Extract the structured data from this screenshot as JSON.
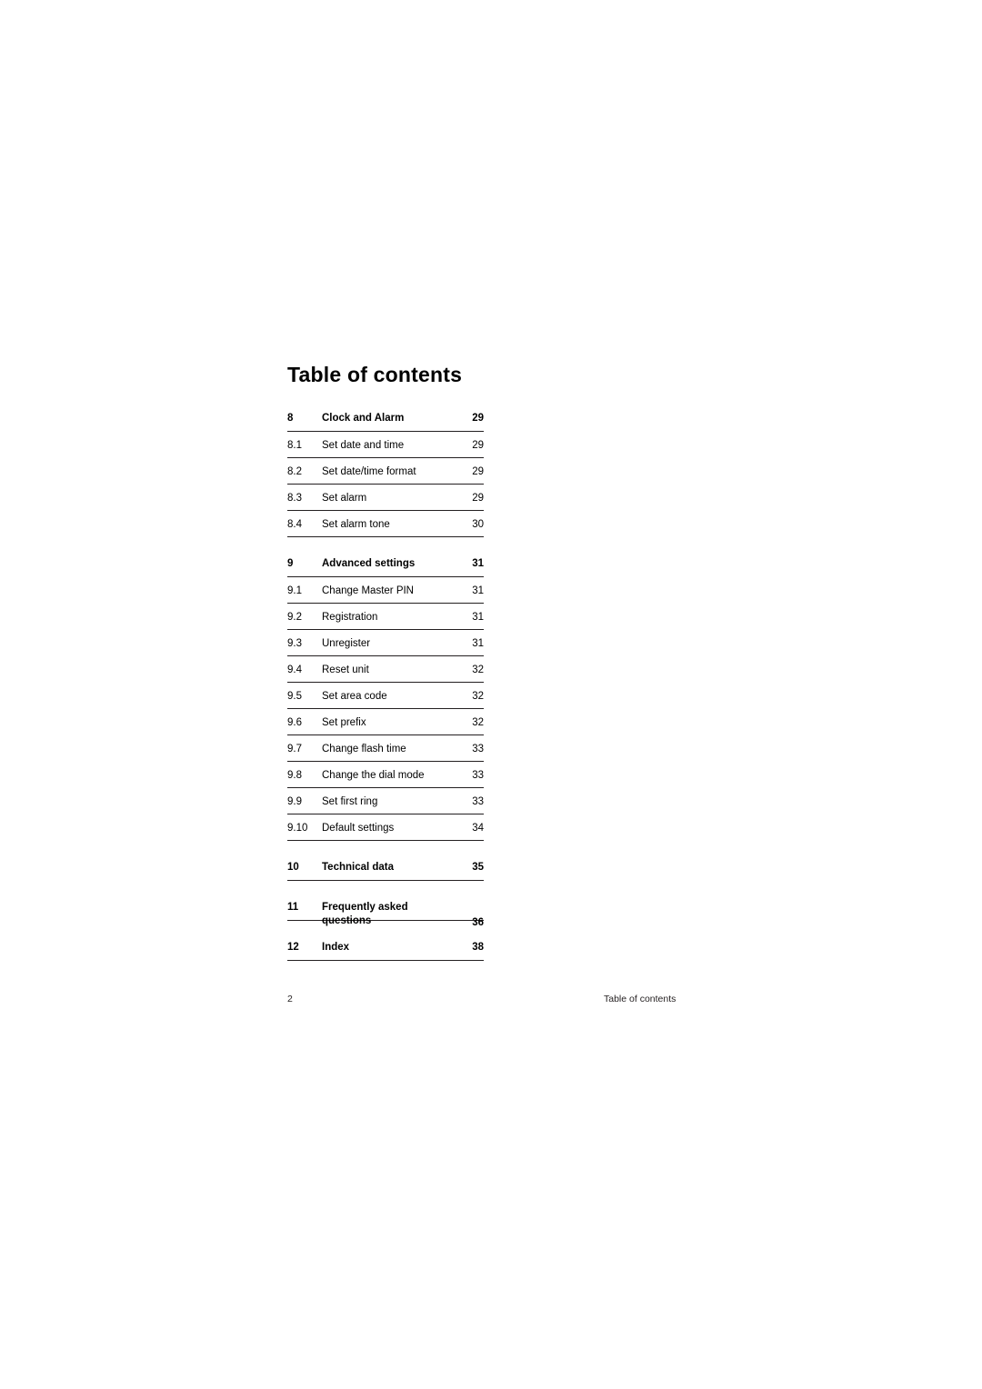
{
  "page": {
    "title": "Table of contents",
    "footer_folio": "2",
    "footer_label": "Table of contents"
  },
  "toc": {
    "groups": [
      {
        "entries": [
          {
            "num": "8",
            "label": "Clock and Alarm",
            "page": "29",
            "chapter": true
          },
          {
            "num": "8.1",
            "label": "Set date and time",
            "page": "29",
            "chapter": false
          },
          {
            "num": "8.2",
            "label": "Set date/time format",
            "page": "29",
            "chapter": false
          },
          {
            "num": "8.3",
            "label": "Set alarm",
            "page": "29",
            "chapter": false
          },
          {
            "num": "8.4",
            "label": "Set alarm tone",
            "page": "30",
            "chapter": false
          }
        ]
      },
      {
        "entries": [
          {
            "num": "9",
            "label": "Advanced settings",
            "page": "31",
            "chapter": true
          },
          {
            "num": "9.1",
            "label": "Change Master PIN",
            "page": "31",
            "chapter": false
          },
          {
            "num": "9.2",
            "label": "Registration",
            "page": "31",
            "chapter": false
          },
          {
            "num": "9.3",
            "label": "Unregister",
            "page": "31",
            "chapter": false
          },
          {
            "num": "9.4",
            "label": "Reset unit",
            "page": "32",
            "chapter": false
          },
          {
            "num": "9.5",
            "label": "Set area code",
            "page": "32",
            "chapter": false
          },
          {
            "num": "9.6",
            "label": "Set prefix",
            "page": "32",
            "chapter": false
          },
          {
            "num": "9.7",
            "label": "Change flash time",
            "page": "33",
            "chapter": false
          },
          {
            "num": "9.8",
            "label": "Change the dial mode",
            "page": "33",
            "chapter": false
          },
          {
            "num": "9.9",
            "label": "Set first ring",
            "page": "33",
            "chapter": false
          },
          {
            "num": "9.10",
            "label": "Default settings",
            "page": "34",
            "chapter": false
          }
        ]
      },
      {
        "entries": [
          {
            "num": "10",
            "label": "Technical data",
            "page": "35",
            "chapter": true
          }
        ]
      },
      {
        "entries": [
          {
            "num": "11",
            "label": "Frequently asked",
            "label2": "questions",
            "page": "36",
            "chapter": true
          }
        ]
      },
      {
        "entries": [
          {
            "num": "12",
            "label": "Index",
            "page": "38",
            "chapter": true
          }
        ]
      }
    ]
  }
}
